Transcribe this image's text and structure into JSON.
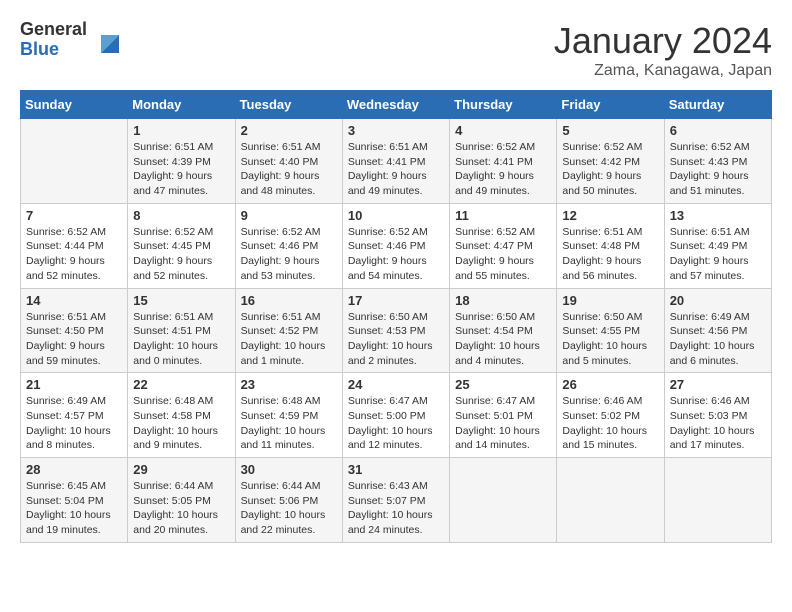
{
  "header": {
    "logo_general": "General",
    "logo_blue": "Blue",
    "month_title": "January 2024",
    "location": "Zama, Kanagawa, Japan"
  },
  "days_of_week": [
    "Sunday",
    "Monday",
    "Tuesday",
    "Wednesday",
    "Thursday",
    "Friday",
    "Saturday"
  ],
  "weeks": [
    [
      {
        "day": "",
        "content": ""
      },
      {
        "day": "1",
        "content": "Sunrise: 6:51 AM\nSunset: 4:39 PM\nDaylight: 9 hours and 47 minutes."
      },
      {
        "day": "2",
        "content": "Sunrise: 6:51 AM\nSunset: 4:40 PM\nDaylight: 9 hours and 48 minutes."
      },
      {
        "day": "3",
        "content": "Sunrise: 6:51 AM\nSunset: 4:41 PM\nDaylight: 9 hours and 49 minutes."
      },
      {
        "day": "4",
        "content": "Sunrise: 6:52 AM\nSunset: 4:41 PM\nDaylight: 9 hours and 49 minutes."
      },
      {
        "day": "5",
        "content": "Sunrise: 6:52 AM\nSunset: 4:42 PM\nDaylight: 9 hours and 50 minutes."
      },
      {
        "day": "6",
        "content": "Sunrise: 6:52 AM\nSunset: 4:43 PM\nDaylight: 9 hours and 51 minutes."
      }
    ],
    [
      {
        "day": "7",
        "content": "Sunrise: 6:52 AM\nSunset: 4:44 PM\nDaylight: 9 hours and 52 minutes."
      },
      {
        "day": "8",
        "content": "Sunrise: 6:52 AM\nSunset: 4:45 PM\nDaylight: 9 hours and 52 minutes."
      },
      {
        "day": "9",
        "content": "Sunrise: 6:52 AM\nSunset: 4:46 PM\nDaylight: 9 hours and 53 minutes."
      },
      {
        "day": "10",
        "content": "Sunrise: 6:52 AM\nSunset: 4:46 PM\nDaylight: 9 hours and 54 minutes."
      },
      {
        "day": "11",
        "content": "Sunrise: 6:52 AM\nSunset: 4:47 PM\nDaylight: 9 hours and 55 minutes."
      },
      {
        "day": "12",
        "content": "Sunrise: 6:51 AM\nSunset: 4:48 PM\nDaylight: 9 hours and 56 minutes."
      },
      {
        "day": "13",
        "content": "Sunrise: 6:51 AM\nSunset: 4:49 PM\nDaylight: 9 hours and 57 minutes."
      }
    ],
    [
      {
        "day": "14",
        "content": "Sunrise: 6:51 AM\nSunset: 4:50 PM\nDaylight: 9 hours and 59 minutes."
      },
      {
        "day": "15",
        "content": "Sunrise: 6:51 AM\nSunset: 4:51 PM\nDaylight: 10 hours and 0 minutes."
      },
      {
        "day": "16",
        "content": "Sunrise: 6:51 AM\nSunset: 4:52 PM\nDaylight: 10 hours and 1 minute."
      },
      {
        "day": "17",
        "content": "Sunrise: 6:50 AM\nSunset: 4:53 PM\nDaylight: 10 hours and 2 minutes."
      },
      {
        "day": "18",
        "content": "Sunrise: 6:50 AM\nSunset: 4:54 PM\nDaylight: 10 hours and 4 minutes."
      },
      {
        "day": "19",
        "content": "Sunrise: 6:50 AM\nSunset: 4:55 PM\nDaylight: 10 hours and 5 minutes."
      },
      {
        "day": "20",
        "content": "Sunrise: 6:49 AM\nSunset: 4:56 PM\nDaylight: 10 hours and 6 minutes."
      }
    ],
    [
      {
        "day": "21",
        "content": "Sunrise: 6:49 AM\nSunset: 4:57 PM\nDaylight: 10 hours and 8 minutes."
      },
      {
        "day": "22",
        "content": "Sunrise: 6:48 AM\nSunset: 4:58 PM\nDaylight: 10 hours and 9 minutes."
      },
      {
        "day": "23",
        "content": "Sunrise: 6:48 AM\nSunset: 4:59 PM\nDaylight: 10 hours and 11 minutes."
      },
      {
        "day": "24",
        "content": "Sunrise: 6:47 AM\nSunset: 5:00 PM\nDaylight: 10 hours and 12 minutes."
      },
      {
        "day": "25",
        "content": "Sunrise: 6:47 AM\nSunset: 5:01 PM\nDaylight: 10 hours and 14 minutes."
      },
      {
        "day": "26",
        "content": "Sunrise: 6:46 AM\nSunset: 5:02 PM\nDaylight: 10 hours and 15 minutes."
      },
      {
        "day": "27",
        "content": "Sunrise: 6:46 AM\nSunset: 5:03 PM\nDaylight: 10 hours and 17 minutes."
      }
    ],
    [
      {
        "day": "28",
        "content": "Sunrise: 6:45 AM\nSunset: 5:04 PM\nDaylight: 10 hours and 19 minutes."
      },
      {
        "day": "29",
        "content": "Sunrise: 6:44 AM\nSunset: 5:05 PM\nDaylight: 10 hours and 20 minutes."
      },
      {
        "day": "30",
        "content": "Sunrise: 6:44 AM\nSunset: 5:06 PM\nDaylight: 10 hours and 22 minutes."
      },
      {
        "day": "31",
        "content": "Sunrise: 6:43 AM\nSunset: 5:07 PM\nDaylight: 10 hours and 24 minutes."
      },
      {
        "day": "",
        "content": ""
      },
      {
        "day": "",
        "content": ""
      },
      {
        "day": "",
        "content": ""
      }
    ]
  ]
}
